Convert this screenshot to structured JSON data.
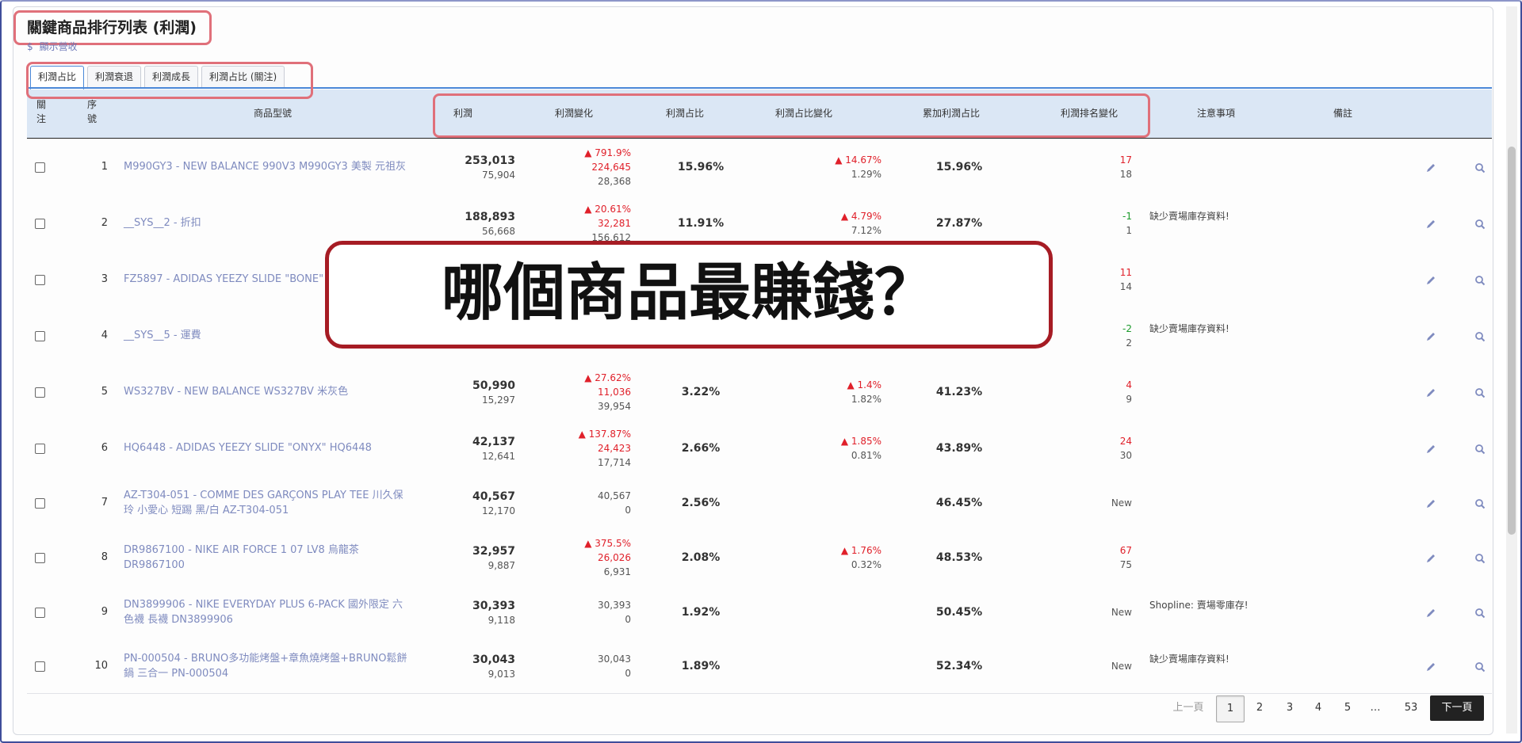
{
  "title": "關鍵商品排行列表 (利潤)",
  "show_revenue": {
    "icon": "$",
    "label": "顯示營收"
  },
  "tabs": [
    {
      "label": "利潤占比",
      "active": true
    },
    {
      "label": "利潤衰退",
      "active": false
    },
    {
      "label": "利潤成長",
      "active": false
    },
    {
      "label": "利潤占比 (關注)",
      "active": false
    }
  ],
  "columns": {
    "watch_1": "關",
    "watch_2": "注",
    "seq_1": "序",
    "seq_2": "號",
    "product": "商品型號",
    "profit": "利潤",
    "profit_change": "利潤變化",
    "profit_share": "利潤占比",
    "share_change": "利潤占比變化",
    "cumulative_share": "累加利潤占比",
    "rank_change": "利潤排名變化",
    "notes": "注意事項",
    "remarks": "備註"
  },
  "rows": [
    {
      "seq": "1",
      "product_1": "M990GY3 - NEW BALANCE 990V3 M990GY3 美製 元祖灰",
      "product_2": "",
      "profit": "253,013",
      "profit_prev": "75,904",
      "chg_pct": "▲ 791.9%",
      "chg_abs": "224,645",
      "chg_prev": "28,368",
      "chg_dir": "up",
      "share": "15.96%",
      "sh_chg": "▲ 14.67%",
      "sh_prev": "1.29%",
      "cum": "15.96%",
      "rank": "17",
      "rank_prev": "18",
      "rank_dir": "up",
      "note": ""
    },
    {
      "seq": "2",
      "product_1": "__SYS__2 - 折扣",
      "product_2": "",
      "profit": "188,893",
      "profit_prev": "56,668",
      "chg_pct": "▲ 20.61%",
      "chg_abs": "32,281",
      "chg_prev": "156,612",
      "chg_dir": "up",
      "share": "11.91%",
      "sh_chg": "▲ 4.79%",
      "sh_prev": "7.12%",
      "cum": "27.87%",
      "rank": "-1",
      "rank_prev": "1",
      "rank_dir": "down",
      "note": "缺少賣場庫存資料!"
    },
    {
      "seq": "3",
      "product_1": "FZ5897 - ADIDAS YEEZY SLIDE \"BONE\" 然",
      "product_2": "",
      "profit": "",
      "profit_prev": "",
      "chg_pct": "",
      "chg_abs": "",
      "chg_prev": "",
      "chg_dir": "none",
      "share": "",
      "sh_chg": "",
      "sh_prev": "",
      "cum": "",
      "rank": "11",
      "rank_prev": "14",
      "rank_dir": "up",
      "note": ""
    },
    {
      "seq": "4",
      "product_1": "__SYS__5 - 運費",
      "product_2": "",
      "profit": "",
      "profit_prev": "",
      "chg_pct": "",
      "chg_abs": "",
      "chg_prev": "",
      "chg_dir": "none",
      "share": "",
      "sh_chg": "",
      "sh_prev": "",
      "cum": "",
      "rank": "-2",
      "rank_prev": "2",
      "rank_dir": "down",
      "note": "缺少賣場庫存資料!"
    },
    {
      "seq": "5",
      "product_1": "WS327BV - NEW BALANCE WS327BV 米灰色",
      "product_2": "",
      "profit": "50,990",
      "profit_prev": "15,297",
      "chg_pct": "▲ 27.62%",
      "chg_abs": "11,036",
      "chg_prev": "39,954",
      "chg_dir": "up",
      "share": "3.22%",
      "sh_chg": "▲ 1.4%",
      "sh_prev": "1.82%",
      "cum": "41.23%",
      "rank": "4",
      "rank_prev": "9",
      "rank_dir": "up",
      "note": ""
    },
    {
      "seq": "6",
      "product_1": "HQ6448 - ADIDAS YEEZY SLIDE \"ONYX\" HQ6448",
      "product_2": "",
      "profit": "42,137",
      "profit_prev": "12,641",
      "chg_pct": "▲ 137.87%",
      "chg_abs": "24,423",
      "chg_prev": "17,714",
      "chg_dir": "up",
      "share": "2.66%",
      "sh_chg": "▲ 1.85%",
      "sh_prev": "0.81%",
      "cum": "43.89%",
      "rank": "24",
      "rank_prev": "30",
      "rank_dir": "up",
      "note": ""
    },
    {
      "seq": "7",
      "product_1": "AZ-T304-051 - COMME DES GARÇONS PLAY TEE 川久保",
      "product_2": "玲 小愛心 短踢 黑/白 AZ-T304-051",
      "profit": "40,567",
      "profit_prev": "12,170",
      "chg_pct": "",
      "chg_abs": "40,567",
      "chg_prev": "0",
      "chg_dir": "plain",
      "share": "2.56%",
      "sh_chg": "",
      "sh_prev": "",
      "cum": "46.45%",
      "rank": "New",
      "rank_prev": "",
      "rank_dir": "new",
      "note": ""
    },
    {
      "seq": "8",
      "product_1": "DR9867100 - NIKE AIR FORCE 1 07 LV8 烏龍茶",
      "product_2": "DR9867100",
      "profit": "32,957",
      "profit_prev": "9,887",
      "chg_pct": "▲ 375.5%",
      "chg_abs": "26,026",
      "chg_prev": "6,931",
      "chg_dir": "up",
      "share": "2.08%",
      "sh_chg": "▲ 1.76%",
      "sh_prev": "0.32%",
      "cum": "48.53%",
      "rank": "67",
      "rank_prev": "75",
      "rank_dir": "up",
      "note": ""
    },
    {
      "seq": "9",
      "product_1": "DN3899906 - NIKE EVERYDAY PLUS 6-PACK 國外限定 六",
      "product_2": "色襪 長襪 DN3899906",
      "profit": "30,393",
      "profit_prev": "9,118",
      "chg_pct": "",
      "chg_abs": "30,393",
      "chg_prev": "0",
      "chg_dir": "plain",
      "share": "1.92%",
      "sh_chg": "",
      "sh_prev": "",
      "cum": "50.45%",
      "rank": "New",
      "rank_prev": "",
      "rank_dir": "new",
      "note": "Shopline: 賣場零庫存!"
    },
    {
      "seq": "10",
      "product_1": "PN-000504 - BRUNO多功能烤盤+章魚燒烤盤+BRUNO鬆餅",
      "product_2": "鍋 三合一 PN-000504",
      "profit": "30,043",
      "profit_prev": "9,013",
      "chg_pct": "",
      "chg_abs": "30,043",
      "chg_prev": "0",
      "chg_dir": "plain",
      "share": "1.89%",
      "sh_chg": "",
      "sh_prev": "",
      "cum": "52.34%",
      "rank": "New",
      "rank_prev": "",
      "rank_dir": "new",
      "note": "缺少賣場庫存資料!"
    }
  ],
  "pagination": {
    "prev": "上一頁",
    "pages": [
      "1",
      "2",
      "3",
      "4",
      "5",
      "…",
      "53"
    ],
    "current": "1",
    "next": "下一頁"
  },
  "overlay_caption": "哪個商品最賺錢？",
  "colors": {
    "up": "#e0202a",
    "down": "#1b9a2b",
    "accent": "#4a88d8",
    "header_bg": "#dbe7f5",
    "highlight": "#e0707a",
    "overlay_border": "#a61c24"
  }
}
